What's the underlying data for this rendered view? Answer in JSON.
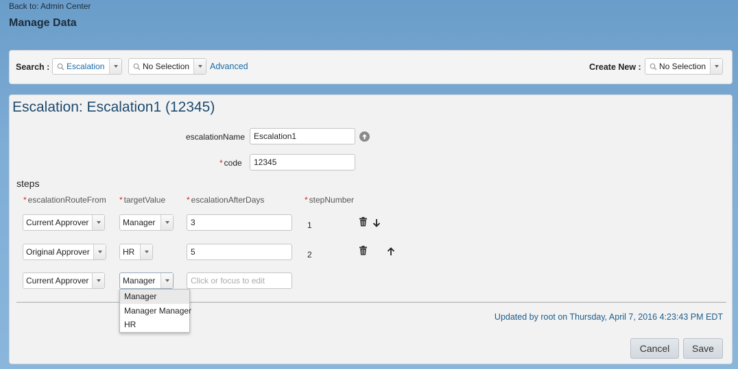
{
  "header": {
    "back_link": "Back to: Admin Center",
    "title": "Manage Data"
  },
  "search_bar": {
    "search_label": "Search :",
    "search_type_value": "Escalation",
    "search_object_value": "No Selection",
    "advanced_link": "Advanced",
    "create_new_label": "Create New :",
    "create_new_value": "No Selection"
  },
  "record": {
    "title": "Escalation: Escalation1 (12345)",
    "fields": {
      "escalation_name_label": "escalationName",
      "escalation_name_value": "Escalation1",
      "code_label": "code",
      "code_value": "12345",
      "required_marker": "*"
    },
    "steps": {
      "section_title": "steps",
      "columns": [
        "escalationRouteFrom",
        "targetValue",
        "escalationAfterDays",
        "stepNumber"
      ],
      "rows": [
        {
          "route_from": "Current Approver",
          "target": "Manager",
          "after_days": "3",
          "step_number": "1"
        },
        {
          "route_from": "Original Approver",
          "target": "HR",
          "after_days": "5",
          "step_number": "2"
        },
        {
          "route_from": "Current Approver",
          "target": "Manager",
          "after_days_placeholder": "Click or focus to edit"
        }
      ]
    },
    "target_dropdown": {
      "options": [
        "Manager",
        "Manager Manager",
        "HR"
      ],
      "highlighted": "Manager"
    },
    "updated_text": "Updated by root on Thursday, April 7, 2016 4:23:43 PM EDT"
  },
  "actions": {
    "cancel_label": "Cancel",
    "save_label": "Save"
  }
}
